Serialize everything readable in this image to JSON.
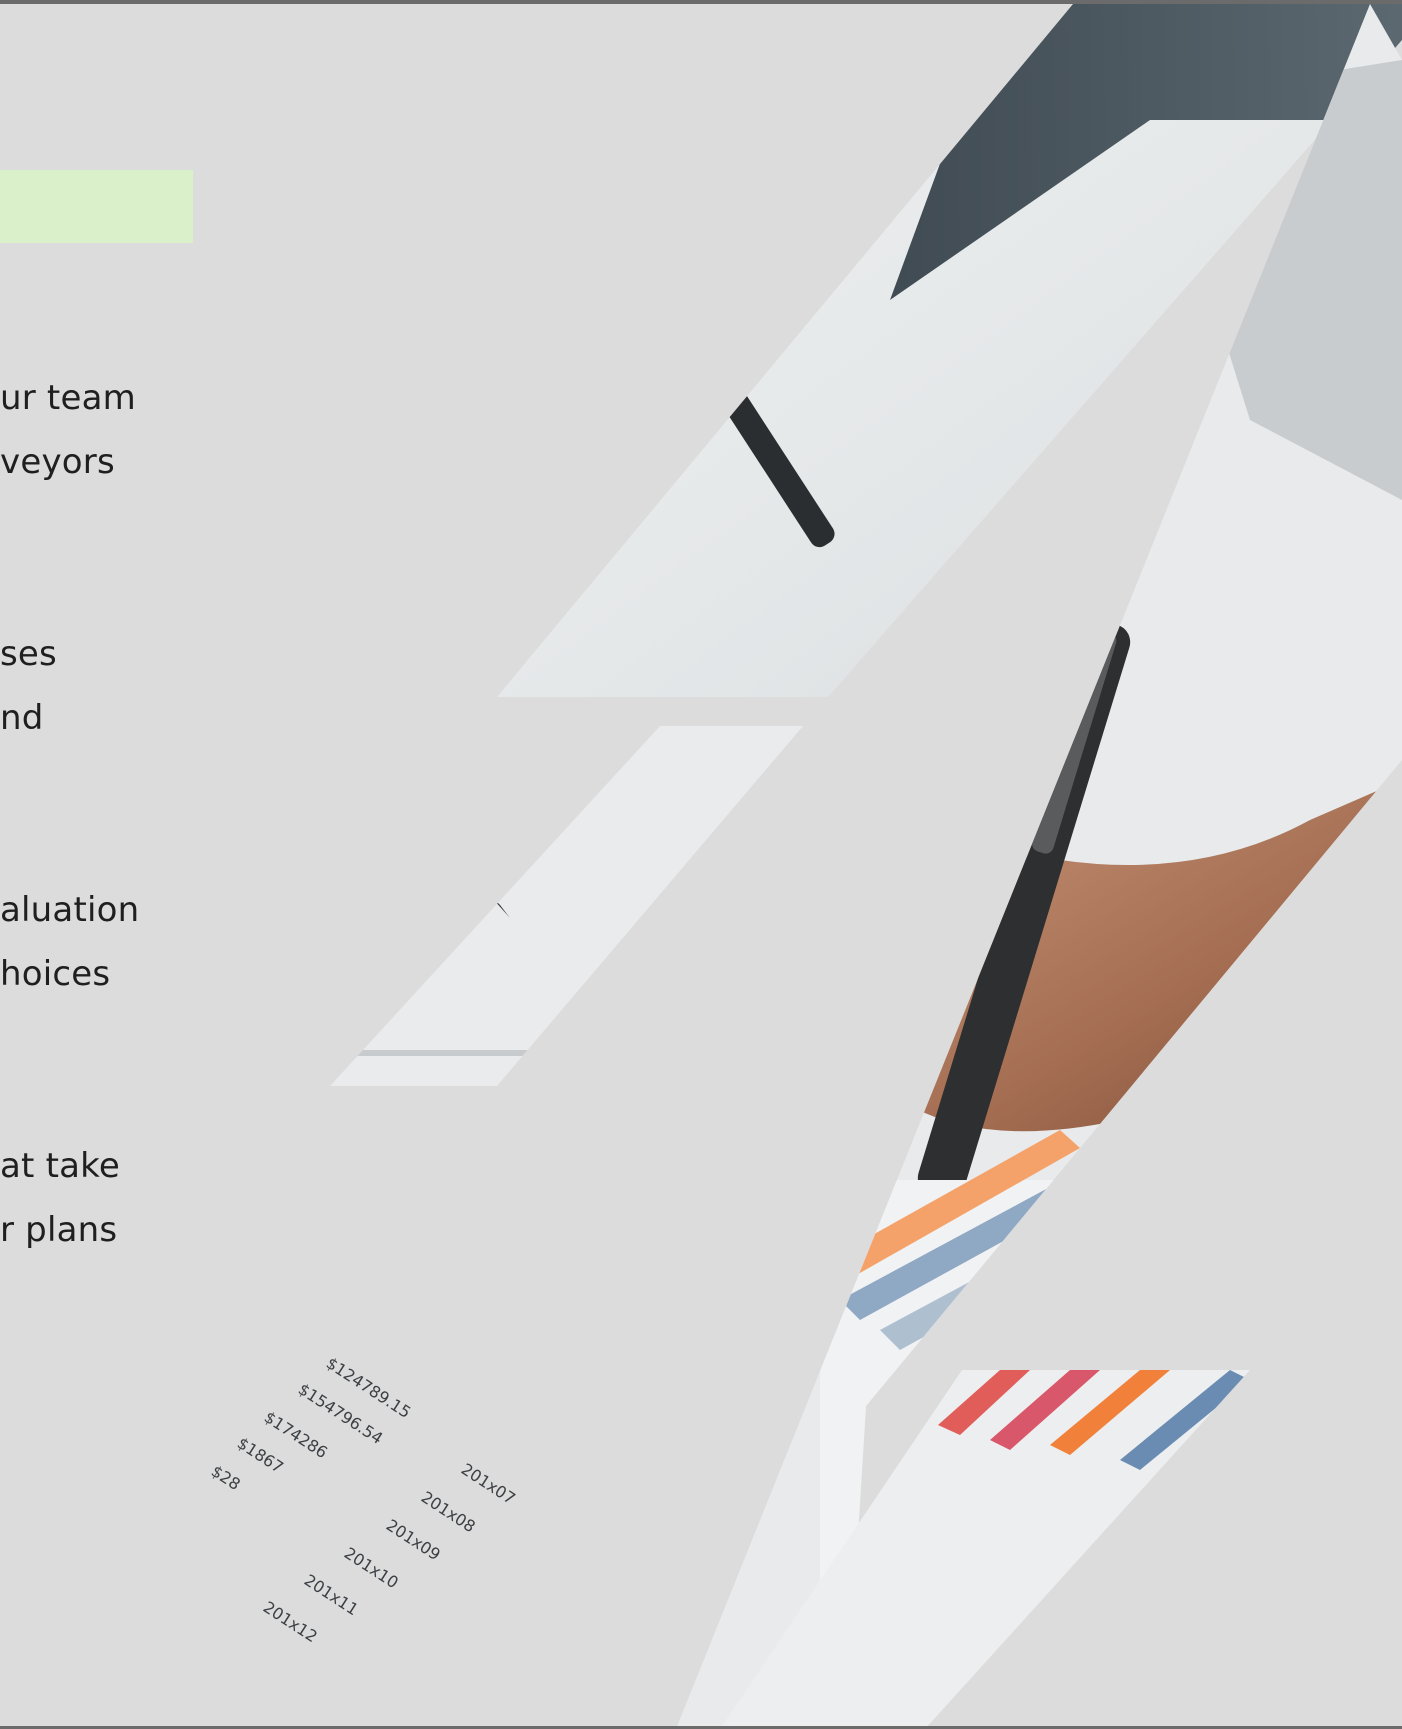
{
  "colors": {
    "background": "#dcdcdc",
    "accent_box": "#daf0cb",
    "frame": "#6b6b6b",
    "text": "#1f1f1f"
  },
  "left_text": {
    "lines": [
      "ur team",
      "veyors",
      "ses",
      "nd",
      "aluation",
      "hoices",
      "at take",
      "r plans"
    ]
  },
  "photo": {
    "chart_labels": [
      "$124789.15",
      "$154796.54",
      "$174286",
      "$1867",
      "$28",
      "201x07",
      "201x08",
      "201x09",
      "201x10",
      "201x11",
      "201x12"
    ]
  }
}
